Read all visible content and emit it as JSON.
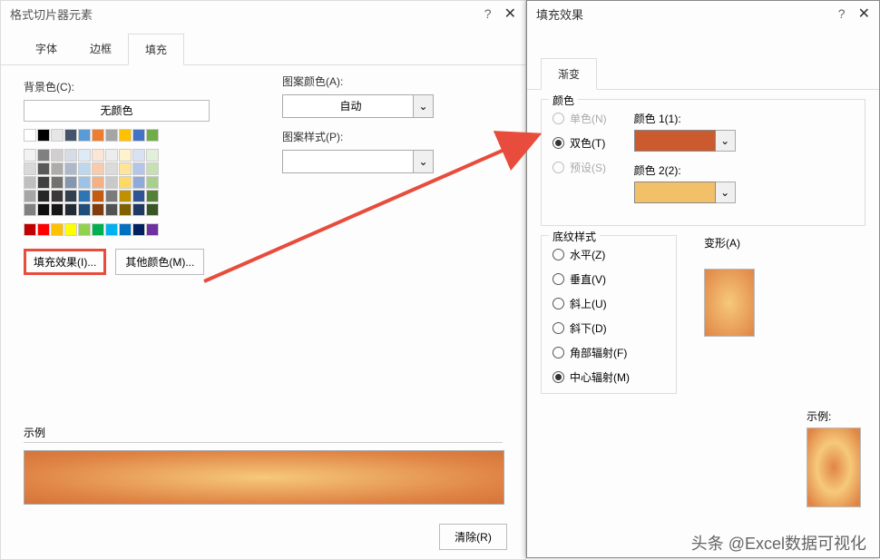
{
  "dialog1": {
    "title": "格式切片器元素",
    "tabs": [
      "字体",
      "边框",
      "填充"
    ],
    "activeTab": 2,
    "bgColorLabel": "背景色(C):",
    "noColorLabel": "无颜色",
    "fillEffectsBtn": "填充效果(I)...",
    "moreColorsBtn": "其他颜色(M)...",
    "patternColorLabel": "图案颜色(A):",
    "patternColorValue": "自动",
    "patternStyleLabel": "图案样式(P):",
    "exampleLabel": "示例",
    "clearBtn": "清除(R)"
  },
  "dialog2": {
    "title": "填充效果",
    "tabs": [
      "渐变"
    ],
    "colorsLegend": "颜色",
    "singleColor": "单色(N)",
    "twoColor": "双色(T)",
    "preset": "预设(S)",
    "color1Label": "颜色 1(1):",
    "color2Label": "颜色 2(2):",
    "shadingLegend": "底纹样式",
    "variantLabel": "变形(A)",
    "shadingOptions": [
      "水平(Z)",
      "垂直(V)",
      "斜上(U)",
      "斜下(D)",
      "角部辐射(F)",
      "中心辐射(M)"
    ],
    "selectedShading": 5,
    "sampleLabel": "示例:",
    "color1": "#cb5a2e",
    "color2": "#f3c06a"
  },
  "colorPalette": {
    "row1": [
      "#ffffff",
      "#000000",
      "#e7e6e6",
      "#44546a",
      "#5b9bd5",
      "#ed7d31",
      "#a5a5a5",
      "#ffc000",
      "#4472c4",
      "#70ad47"
    ],
    "theme": [
      [
        "#f2f2f2",
        "#808080",
        "#d0cece",
        "#d6dce4",
        "#deebf6",
        "#fce4d6",
        "#ededed",
        "#fff2cc",
        "#d9e2f3",
        "#e2efd9"
      ],
      [
        "#d9d9d9",
        "#595959",
        "#aeabab",
        "#adb9ca",
        "#bdd7ee",
        "#f8cbad",
        "#dbdbdb",
        "#fee599",
        "#b4c6e7",
        "#c5e0b3"
      ],
      [
        "#bfbfbf",
        "#404040",
        "#757070",
        "#8496b0",
        "#9cc3e5",
        "#f4b183",
        "#c9c9c9",
        "#ffd965",
        "#8eaadb",
        "#a8d08d"
      ],
      [
        "#a6a6a6",
        "#262626",
        "#3a3838",
        "#323f4f",
        "#2e75b5",
        "#c55a11",
        "#7b7b7b",
        "#bf9000",
        "#2f5496",
        "#538135"
      ],
      [
        "#808080",
        "#0d0d0d",
        "#171616",
        "#222a35",
        "#1e4e79",
        "#833c0b",
        "#525252",
        "#7f6000",
        "#1f3864",
        "#375623"
      ]
    ],
    "standard": [
      "#c00000",
      "#ff0000",
      "#ffc000",
      "#ffff00",
      "#92d050",
      "#00b050",
      "#00b0f0",
      "#0070c0",
      "#002060",
      "#7030a0"
    ]
  },
  "watermark": "头条 @Excel数据可视化"
}
